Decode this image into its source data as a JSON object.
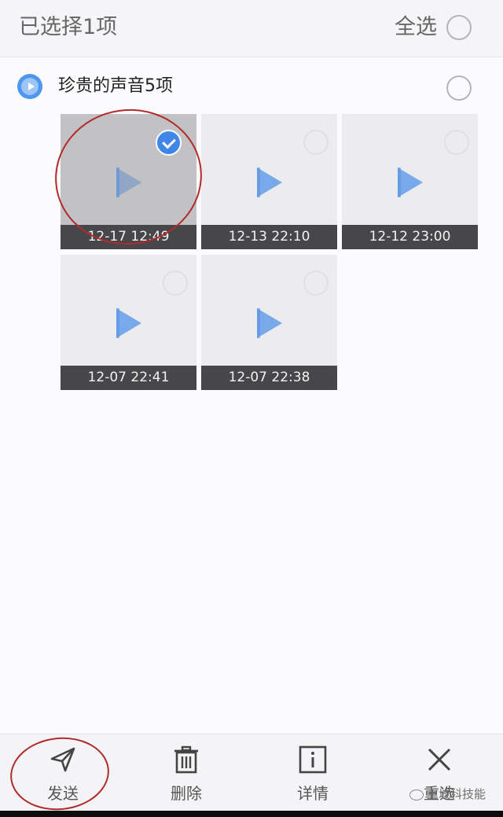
{
  "header": {
    "title": "已选择1项",
    "select_all_label": "全选"
  },
  "group": {
    "title": "珍贵的声音5项",
    "icon": "audio-play-icon"
  },
  "recordings": [
    {
      "timestamp": "12-17 12:49",
      "selected": true
    },
    {
      "timestamp": "12-13 22:10",
      "selected": false
    },
    {
      "timestamp": "12-12 23:00",
      "selected": false
    },
    {
      "timestamp": "12-07 22:41",
      "selected": false
    },
    {
      "timestamp": "12-07 22:38",
      "selected": false
    }
  ],
  "actions": [
    {
      "label": "发送",
      "icon": "send-icon"
    },
    {
      "label": "删除",
      "icon": "trash-icon"
    },
    {
      "label": "详情",
      "icon": "info-icon"
    },
    {
      "label": "重选",
      "icon": "close-icon"
    }
  ],
  "watermark": "重城科技能",
  "colors": {
    "accent": "#3f86e8",
    "annotation": "#b22a2a",
    "stamp_bg": "#47474a"
  }
}
